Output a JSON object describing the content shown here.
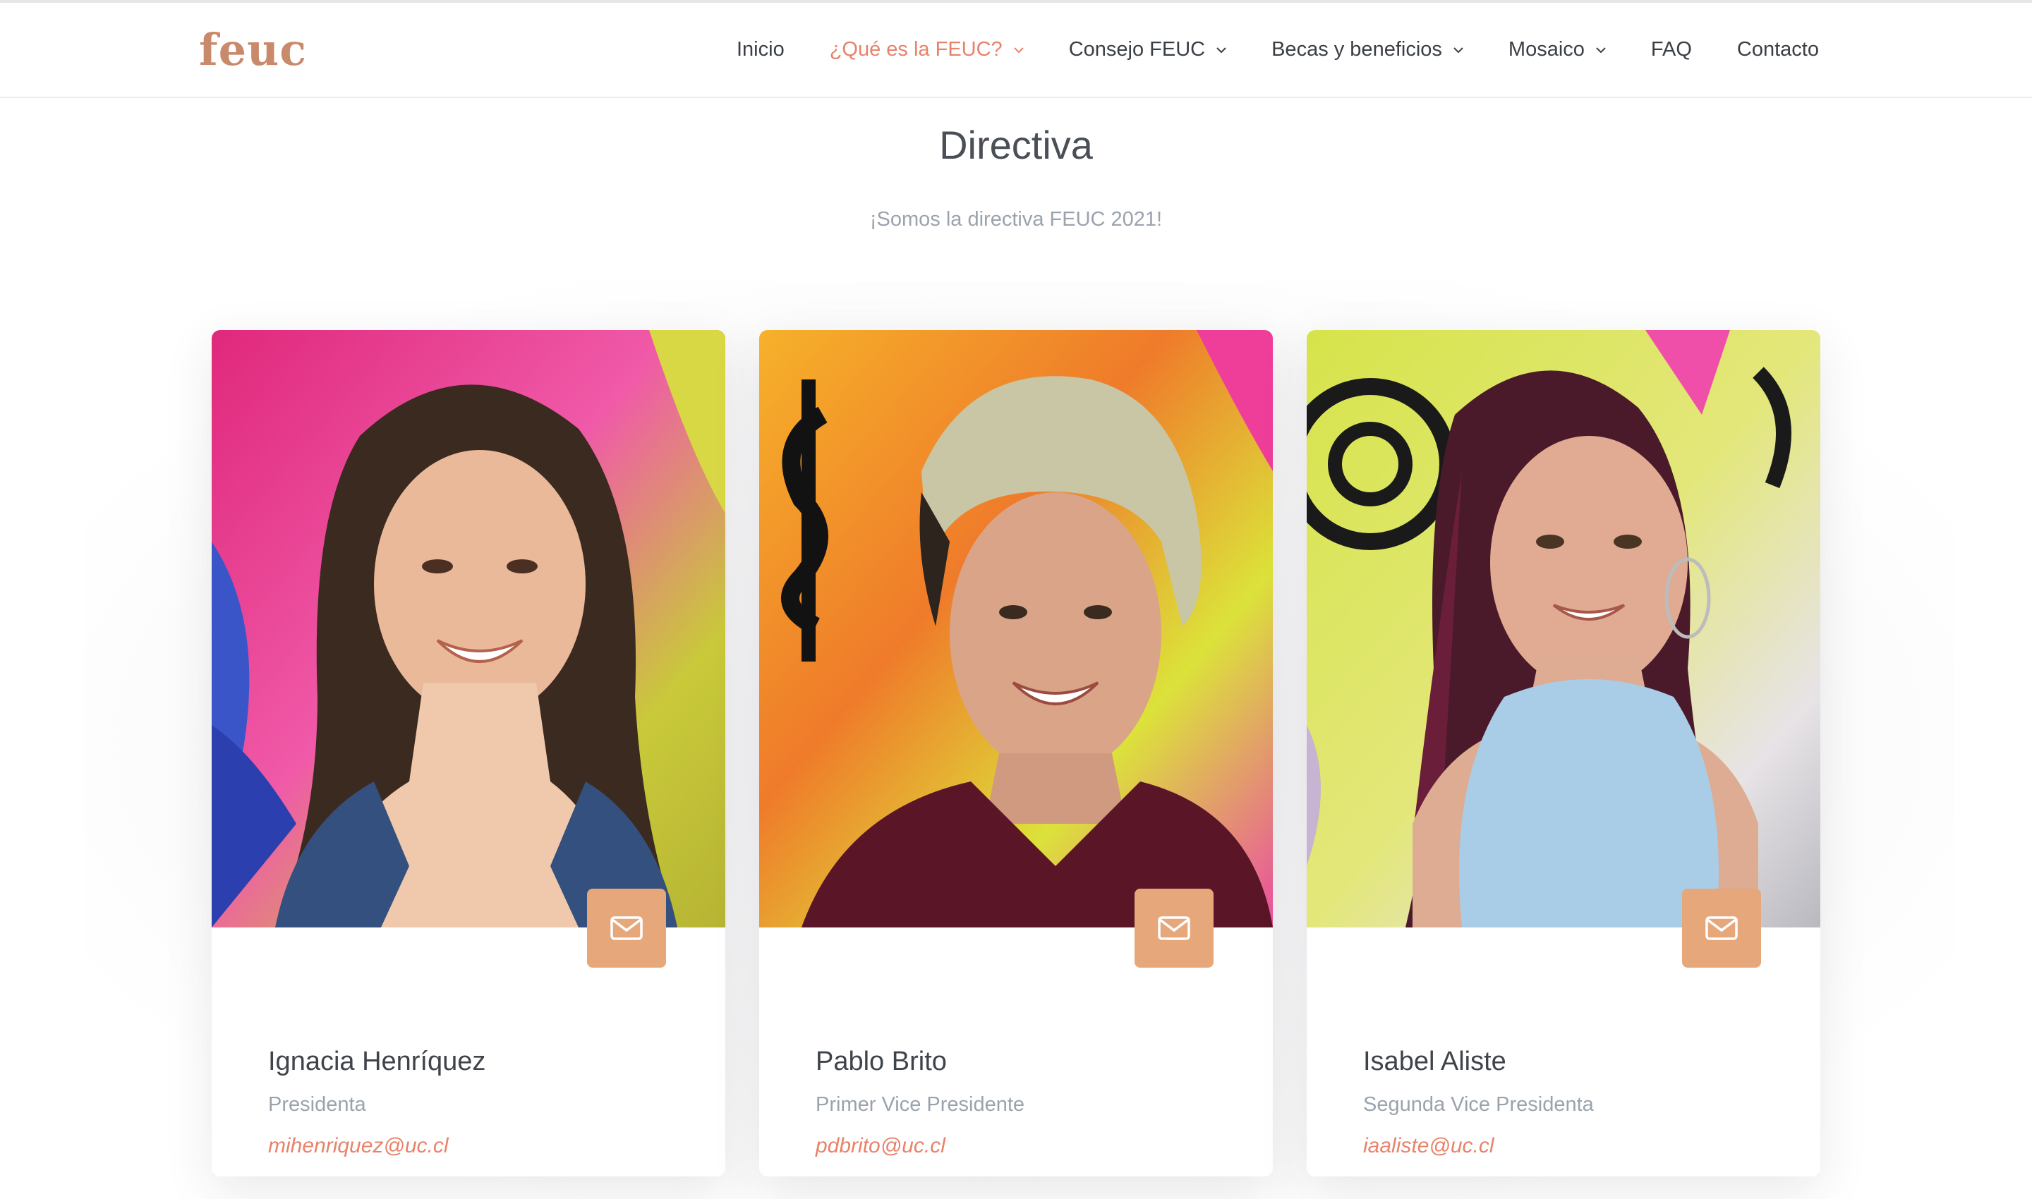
{
  "header": {
    "logo": "feuc",
    "nav": [
      {
        "label": "Inicio",
        "dropdown": false,
        "active": false
      },
      {
        "label": "¿Qué es la FEUC?",
        "dropdown": true,
        "active": true
      },
      {
        "label": "Consejo FEUC",
        "dropdown": true,
        "active": false
      },
      {
        "label": "Becas y beneficios",
        "dropdown": true,
        "active": false
      },
      {
        "label": "Mosaico",
        "dropdown": true,
        "active": false
      },
      {
        "label": "FAQ",
        "dropdown": false,
        "active": false
      },
      {
        "label": "Contacto",
        "dropdown": false,
        "active": false
      }
    ]
  },
  "section": {
    "title": "Directiva",
    "subtitle": "¡Somos la directiva FEUC 2021!"
  },
  "members": [
    {
      "name": "Ignacia Henríquez",
      "role": "Presidenta",
      "email": "mihenriquez@uc.cl"
    },
    {
      "name": "Pablo Brito",
      "role": "Primer Vice Presidente",
      "email": "pdbrito@uc.cl"
    },
    {
      "name": "Isabel Aliste",
      "role": "Segunda Vice Presidenta",
      "email": "iaaliste@uc.cl"
    }
  ],
  "colors": {
    "accent": "#e8826a",
    "logo": "#c98a6c",
    "mail_button": "#e6a77a",
    "muted_text": "#9aa3ad"
  },
  "icons": {
    "mail": "envelope-icon",
    "dropdown": "chevron-down-icon"
  }
}
